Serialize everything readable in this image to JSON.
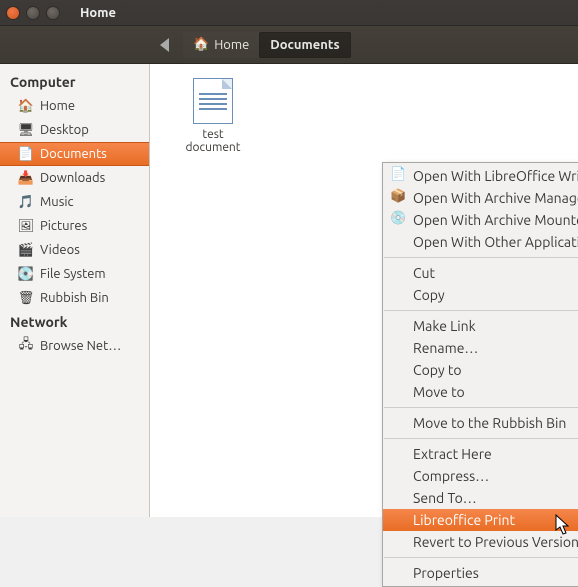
{
  "window": {
    "title": "Home"
  },
  "breadcrumbs": {
    "home": "Home",
    "current": "Documents"
  },
  "sidebar": {
    "sections": [
      {
        "title": "Computer",
        "items": [
          {
            "id": "home",
            "label": "Home",
            "icon": "🏠",
            "active": false
          },
          {
            "id": "desktop",
            "label": "Desktop",
            "icon": "🖥",
            "active": false
          },
          {
            "id": "documents",
            "label": "Documents",
            "icon": "📄",
            "active": true
          },
          {
            "id": "downloads",
            "label": "Downloads",
            "icon": "📥",
            "active": false
          },
          {
            "id": "music",
            "label": "Music",
            "icon": "🎵",
            "active": false
          },
          {
            "id": "pictures",
            "label": "Pictures",
            "icon": "🖼",
            "active": false
          },
          {
            "id": "videos",
            "label": "Videos",
            "icon": "🎬",
            "active": false
          },
          {
            "id": "filesystem",
            "label": "File System",
            "icon": "💽",
            "active": false
          },
          {
            "id": "rubbish",
            "label": "Rubbish Bin",
            "icon": "🗑",
            "active": false
          }
        ]
      },
      {
        "title": "Network",
        "items": [
          {
            "id": "browse-net",
            "label": "Browse Net…",
            "icon": "🖧",
            "active": false
          }
        ]
      }
    ]
  },
  "file": {
    "name": "test document"
  },
  "context_menu": {
    "groups": [
      [
        {
          "id": "open-writer",
          "label": "Open With LibreOffice Writer",
          "icon": "📄",
          "submenu": false,
          "highlight": false
        },
        {
          "id": "open-archive-mgr",
          "label": "Open With Archive Manager",
          "icon": "📦",
          "submenu": false,
          "highlight": false
        },
        {
          "id": "open-archive-mount",
          "label": "Open With Archive Mounter",
          "icon": "💿",
          "submenu": false,
          "highlight": false
        },
        {
          "id": "open-other",
          "label": "Open With Other Application…",
          "icon": "",
          "submenu": false,
          "highlight": false
        }
      ],
      [
        {
          "id": "cut",
          "label": "Cut",
          "icon": "",
          "submenu": false,
          "highlight": false
        },
        {
          "id": "copy",
          "label": "Copy",
          "icon": "",
          "submenu": false,
          "highlight": false
        }
      ],
      [
        {
          "id": "make-link",
          "label": "Make Link",
          "icon": "",
          "submenu": false,
          "highlight": false
        },
        {
          "id": "rename",
          "label": "Rename…",
          "icon": "",
          "submenu": false,
          "highlight": false
        },
        {
          "id": "copy-to",
          "label": "Copy to",
          "icon": "",
          "submenu": true,
          "highlight": false
        },
        {
          "id": "move-to",
          "label": "Move to",
          "icon": "",
          "submenu": true,
          "highlight": false
        }
      ],
      [
        {
          "id": "trash",
          "label": "Move to the Rubbish Bin",
          "icon": "",
          "submenu": false,
          "highlight": false
        }
      ],
      [
        {
          "id": "extract",
          "label": "Extract Here",
          "icon": "",
          "submenu": false,
          "highlight": false
        },
        {
          "id": "compress",
          "label": "Compress…",
          "icon": "",
          "submenu": false,
          "highlight": false
        },
        {
          "id": "send-to",
          "label": "Send To…",
          "icon": "",
          "submenu": false,
          "highlight": false
        },
        {
          "id": "lo-print",
          "label": "Libreoffice Print",
          "icon": "",
          "submenu": false,
          "highlight": true
        },
        {
          "id": "revert",
          "label": "Revert to Previous Version…",
          "icon": "",
          "submenu": false,
          "highlight": false
        }
      ],
      [
        {
          "id": "properties",
          "label": "Properties",
          "icon": "",
          "submenu": false,
          "highlight": false
        }
      ]
    ]
  }
}
